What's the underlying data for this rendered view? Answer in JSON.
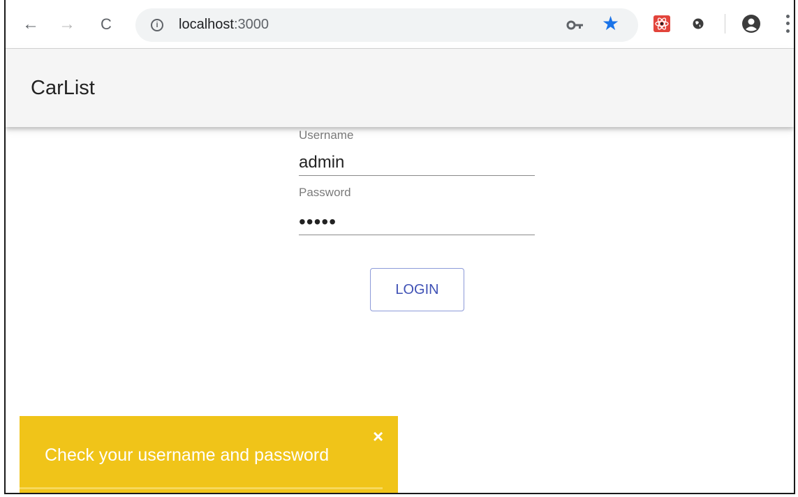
{
  "browser": {
    "url_host": "localhost",
    "url_port": ":3000",
    "back_glyph": "←",
    "forward_glyph": "→",
    "reload_glyph": "C",
    "info_glyph": "i",
    "star_glyph": "★",
    "icons": [
      "back-icon",
      "forward-icon",
      "reload-icon",
      "info-icon",
      "key-icon",
      "star-icon",
      "react-devtools-icon",
      "extension-icon",
      "account-icon",
      "menu-icon"
    ],
    "colors": {
      "star": "#1a73e8",
      "omnibox": "#f1f3f4"
    }
  },
  "appbar": {
    "title": "CarList",
    "background": "#f5f5f5"
  },
  "login": {
    "username_label": "Username",
    "username_value": "admin",
    "password_label": "Password",
    "password_value": "•••••",
    "button_label": "LOGIN",
    "button_color": "#3f51b5"
  },
  "snackbar": {
    "message": "Check your username and password",
    "close_glyph": "×",
    "background": "#f0c419"
  }
}
